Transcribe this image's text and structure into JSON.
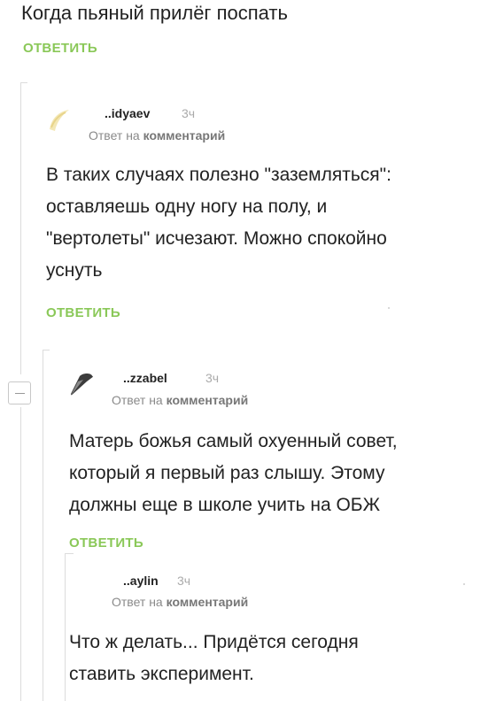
{
  "post": {
    "top_text": "Когда пьяный прилёг поспать",
    "reply_label": "ОТВЕТИТЬ"
  },
  "comments": [
    {
      "author": "..idyaev",
      "time": "3ч",
      "meta_prefix": "Ответ на",
      "meta_link": "комментарий",
      "lines": [
        "В таких случаях полезно \"заземляться\":",
        "оставляешь одну ногу на полу, и",
        "\"вертолеты\" исчезают. Можно спокойно",
        "уснуть"
      ],
      "reply_label": "ОТВЕТИТЬ"
    },
    {
      "author": "..zzabel",
      "time": "3ч",
      "meta_prefix": "Ответ на",
      "meta_link": "комментарий",
      "lines": [
        "Матерь божья самый охуенный совет,",
        "который я первый раз слышу. Этому",
        "должны еще в школе учить на ОБЖ"
      ],
      "reply_label": "ОТВЕТИТЬ"
    },
    {
      "author": "..aylin",
      "time": "3ч",
      "meta_prefix": "Ответ на",
      "meta_link": "комментарий",
      "lines": [
        "Что ж делать... Придётся сегодня",
        "ставить эксперимент."
      ]
    }
  ],
  "icons": {
    "collapse": "minus-icon"
  }
}
